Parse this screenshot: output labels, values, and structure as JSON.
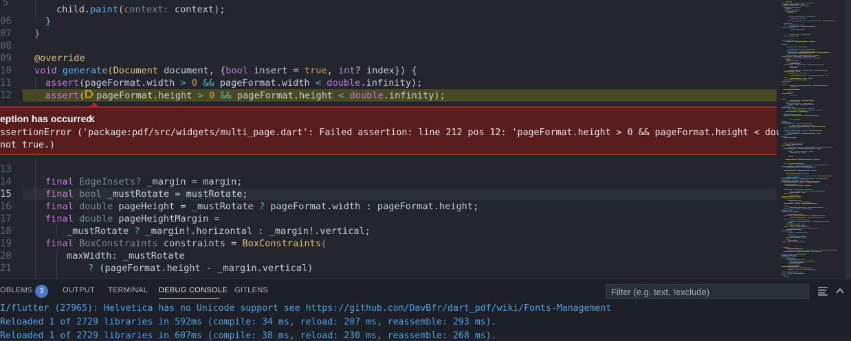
{
  "editor": {
    "line_numbers": [
      {
        "text": "5"
      },
      {
        "text": "06"
      },
      {
        "text": "07"
      },
      {
        "text": "08"
      },
      {
        "text": "09"
      },
      {
        "text": "10"
      },
      {
        "text": "11"
      },
      {
        "text": "12"
      },
      {
        "text": "13"
      },
      {
        "text": "14"
      },
      {
        "text": "15"
      },
      {
        "text": "16"
      },
      {
        "text": "17"
      },
      {
        "text": "18"
      },
      {
        "text": "19"
      },
      {
        "text": "20"
      },
      {
        "text": "21"
      }
    ],
    "code": {
      "l205_call": "child.",
      "l205_fn": "paint",
      "l205_open": "(",
      "l205_param": "context:",
      "l205_rest": " context);",
      "l206": "}",
      "l207": "}",
      "l209": "@override",
      "l210_kw": "void ",
      "l210_fn": "generate",
      "l210_open": "(",
      "l210_type": "Document",
      "l210_a": " document, {",
      "l210_b": "bool",
      "l210_c": " insert = ",
      "l210_d": "true",
      "l210_e": ", ",
      "l210_f": "int",
      "l210_g": "? index}) {",
      "l211_fn": "assert",
      "l211_a": "(pageFormat.width ",
      "l211_op1": ">",
      "l211_sp1": " ",
      "l211_num": "0",
      "l211_sp2": " ",
      "l211_op2": "&&",
      "l211_b": " pageFormat.width ",
      "l211_op3": "<",
      "l211_sp3": " ",
      "l211_kw": "double",
      "l211_c": ".infinity);",
      "l212_fn": "assert",
      "l212_a": "(",
      "l212_b": "pageFormat.height ",
      "l212_op1": ">",
      "l212_sp1": " ",
      "l212_num": "0",
      "l212_sp2": " ",
      "l212_op2": "&&",
      "l212_c": " pageFormat.height ",
      "l212_op3": "<",
      "l212_sp3": " ",
      "l212_kw": "double",
      "l212_d": ".infinity);",
      "l214_kw": "final ",
      "l214_type": "EdgeInsets?",
      "l214_a": " _margin = margin;",
      "l215_kw": "final ",
      "l215_type": "bool",
      "l215_a": " _mustRotate = mustRotate;",
      "l216_kw": "final ",
      "l216_type": "double",
      "l216_a": " pageHeight = _mustRotate ",
      "l216_op": "?",
      "l216_b": " pageFormat.width : pageFormat.height;",
      "l217_kw": "final ",
      "l217_type": "double",
      "l217_a": " pageHeightMargin =",
      "l218_a": "_mustRotate ",
      "l218_op": "?",
      "l218_b": " _margin!.horizontal : _margin!.vertical;",
      "l219_kw": "final ",
      "l219_type": "BoxConstraints",
      "l219_a": " constraints = ",
      "l219_fn": "BoxConstraints",
      "l219_open": "(",
      "l220_a": "maxWidth: _mustRotate",
      "l221_op": "?",
      "l221_a": " (pageFormat.height ",
      "l221_op2": "-",
      "l221_b": " _margin.vertical)"
    }
  },
  "exception": {
    "title": "eption has occurred.",
    "close_icon": "close-icon",
    "message_line1": "ssertionError ('package:pdf/src/widgets/multi_page.dart': Failed assertion: line 212 pos 12: 'pageFormat.height > 0 && pageFormat.height < double.infinity':",
    "message_line2": "not true.)"
  },
  "panel": {
    "tabs": [
      {
        "label": "OBLEMS"
      },
      {
        "label": "OUTPUT"
      },
      {
        "label": "TERMINAL"
      },
      {
        "label": "DEBUG CONSOLE"
      },
      {
        "label": "GITLENS"
      }
    ],
    "problems_count": "3",
    "active_tab": "DEBUG CONSOLE",
    "filter_placeholder": "Filter (e.g. text, !exclude)",
    "icons": [
      "word-wrap-icon",
      "chevron-up-icon"
    ],
    "console_lines": [
      {
        "text": "I/flutter (27965): Helvetica has no Unicode support see https://github.com/DavBfr/dart_pdf/wiki/Fonts-Management"
      },
      {
        "text": "Reloaded 1 of 2729 libraries in 592ms (compile: 34 ms, reload: 207 ms, reassemble: 293 ms)."
      },
      {
        "text": "Reloaded 1 of 2729 libraries in 607ms (compile: 38 ms, reload: 230 ms, reassemble: 268 ms)."
      }
    ]
  },
  "colors": {
    "exception_bg": "#5a1d1d",
    "exception_border": "#b3261e",
    "current_line": "#4a4a22",
    "accent_badge": "#4d78cc",
    "console_text": "#4ea1e8"
  }
}
